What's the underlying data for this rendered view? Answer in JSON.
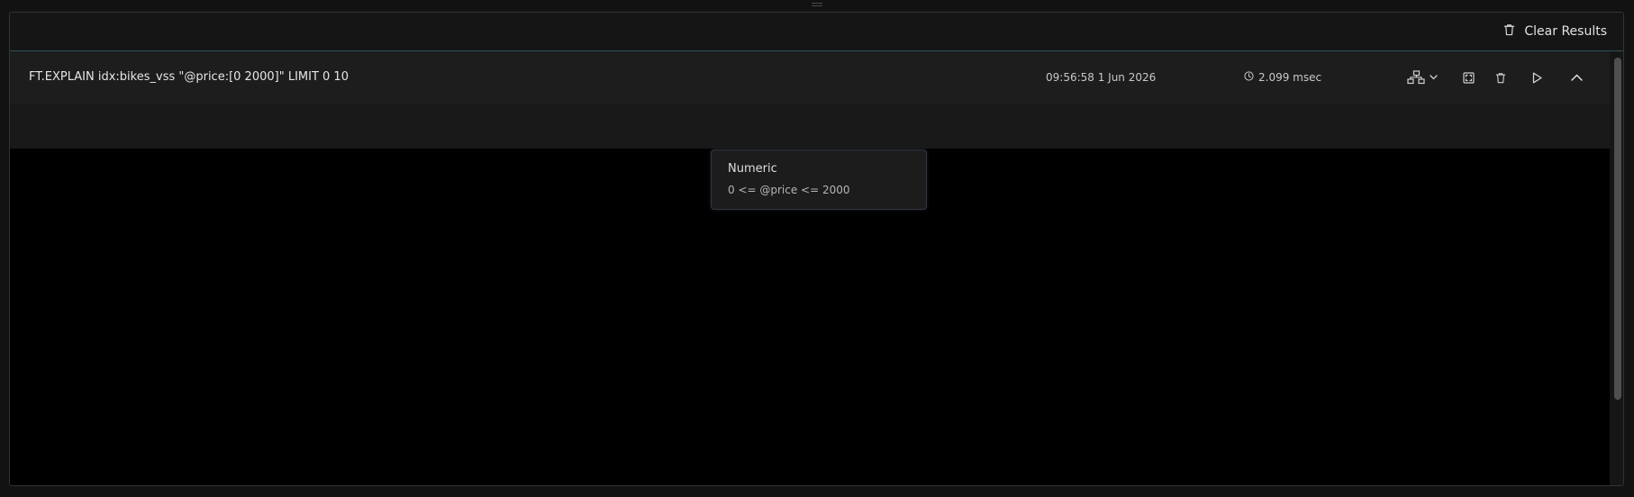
{
  "toolbar": {
    "clear_results_label": "Clear Results",
    "clear_icon": "trash-icon"
  },
  "result": {
    "command": "FT.EXPLAIN idx:bikes_vss \"@price:[0 2000]\" LIMIT 0 10",
    "timestamp": "09:56:58 1 Jun 2026",
    "duration": "2.099 msec",
    "duration_icon": "clock-icon",
    "actions": [
      {
        "name": "view-mode-dropdown",
        "icon": "tree-view-icon"
      },
      {
        "name": "fullscreen-button",
        "icon": "fullscreen-icon"
      },
      {
        "name": "delete-button",
        "icon": "trash-icon"
      },
      {
        "name": "rerun-button",
        "icon": "play-icon"
      },
      {
        "name": "collapse-button",
        "icon": "chevron-up-icon"
      }
    ]
  },
  "explain_tree": {
    "nodes": [
      {
        "type": "Numeric",
        "expression": "0 <= @price <= 2000"
      }
    ]
  },
  "colors": {
    "background": "#121212",
    "row": "#1d1d1d",
    "viewer": "#000000",
    "accent_border": "#2f4f55"
  }
}
